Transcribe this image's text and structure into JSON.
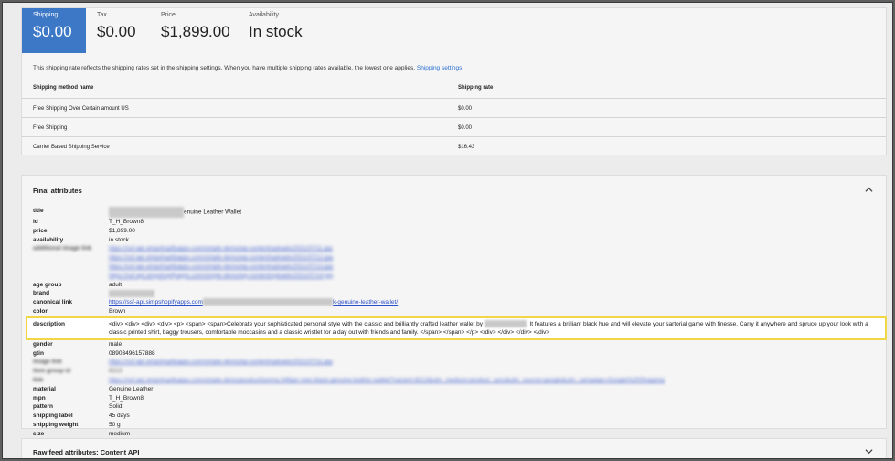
{
  "metrics": [
    {
      "label": "Shipping",
      "value": "$0.00",
      "active": true
    },
    {
      "label": "Tax",
      "value": "$0.00"
    },
    {
      "label": "Price",
      "value": "$1,899.00"
    },
    {
      "label": "Availability",
      "value": "In stock"
    }
  ],
  "note": {
    "text": "This shipping rate reflects the shipping rates set in the shipping settings. When you have multiple shipping rates available, the lowest one applies.",
    "link": "Shipping settings"
  },
  "shipping_table": {
    "headers": [
      "Shipping method name",
      "Shipping rate"
    ],
    "rows": [
      [
        "Free Shipping Over Certain amount US",
        "$0.00"
      ],
      [
        "Free Shipping",
        "$0.00"
      ],
      [
        "Carrier Based Shipping Service",
        "$16.43"
      ]
    ]
  },
  "final_attributes": {
    "title": "Final attributes",
    "items": {
      "title_k": "title",
      "title_v": "enuine Leather Wallet",
      "id_k": "id",
      "id_v": "T_H_Brown8",
      "price_k": "price",
      "price_v": "$1,899.00",
      "availability_k": "availability",
      "availability_v": "in stock",
      "additional_image_k": "additional image link",
      "additional_image_v": [
        "https://ssf-api.simpshopifyapps.com/simple-demo/wp-content/uploads/2021/07/11.jpg",
        "https://ssf-api.simpshopifyapps.com/simple-demo/wp-content/uploads/2021/07/12.jpg",
        "https://ssf-api.simpshopifyapps.com/simple-demo/wp-content/uploads/2021/07/13.jpg",
        "https://ssf-api.simpshopifyapps.com/simple-demo/wp-content/uploads/2021/07/14.jpg"
      ],
      "age_group_k": "age group",
      "age_group_v": "adult",
      "brand_k": "brand",
      "canonical_k": "canonical link",
      "canonical_v1": "https://ssf-api.simpshopifyapps.com",
      "canonical_v2": "k-genuine-leather-wallet/",
      "color_k": "color",
      "color_v": "Brown",
      "description_k": "description",
      "description_v1": "<div> <div> <div> <div> <p> <span> <span>Celebrate your sophisticated personal style with the classic and brilliantly crafted leather wallet by",
      "description_v2": ". It features a brilliant black hue and will elevate your sartorial game with finesse. Carry it anywhere and spruce up your look with a classic printed shirt, baggy trousers, comfortable moccasins and a classic wristlet for a day out with friends and family. </span> </span> </p> </div> </div> </div> </div>",
      "gender_k": "gender",
      "gender_v": "male",
      "gtin_k": "gtin",
      "gtin_v": "08903496157888",
      "image_k": "image link",
      "image_v": "https://ssf-api.simpshopifyapps.com/simple-demo/wp-content/uploads/2021/07/11.jpg",
      "item_group_k": "item group id",
      "item_group_v": "8213",
      "link_k": "link",
      "link_v": "https://ssf-api.simpshopifyapps.com/simple-demo/product/tommy-hilfiger-men-black-genuine-leather-wallet/?variant=8213&utm_medium=product_sync&utm_source=google&utm_campaign=Google%20Shopping",
      "material_k": "material",
      "material_v": "Genuine Leather",
      "mpn_k": "mpn",
      "mpn_v": "T_H_Brown8",
      "pattern_k": "pattern",
      "pattern_v": "Solid",
      "shipping_label_k": "shipping label",
      "shipping_label_v": "45 days",
      "shipping_weight_k": "shipping weight",
      "shipping_weight_v": "50 g",
      "size_k": "size",
      "size_v": "medium"
    }
  },
  "raw_feed": {
    "title": "Raw feed attributes: Content API"
  },
  "colors": {
    "accent": "#3c78c6",
    "link": "#2a6fcf",
    "highlight": "#f1d646"
  },
  "icons": {
    "collapse": "chevron-up-icon",
    "expand": "chevron-down-icon"
  }
}
